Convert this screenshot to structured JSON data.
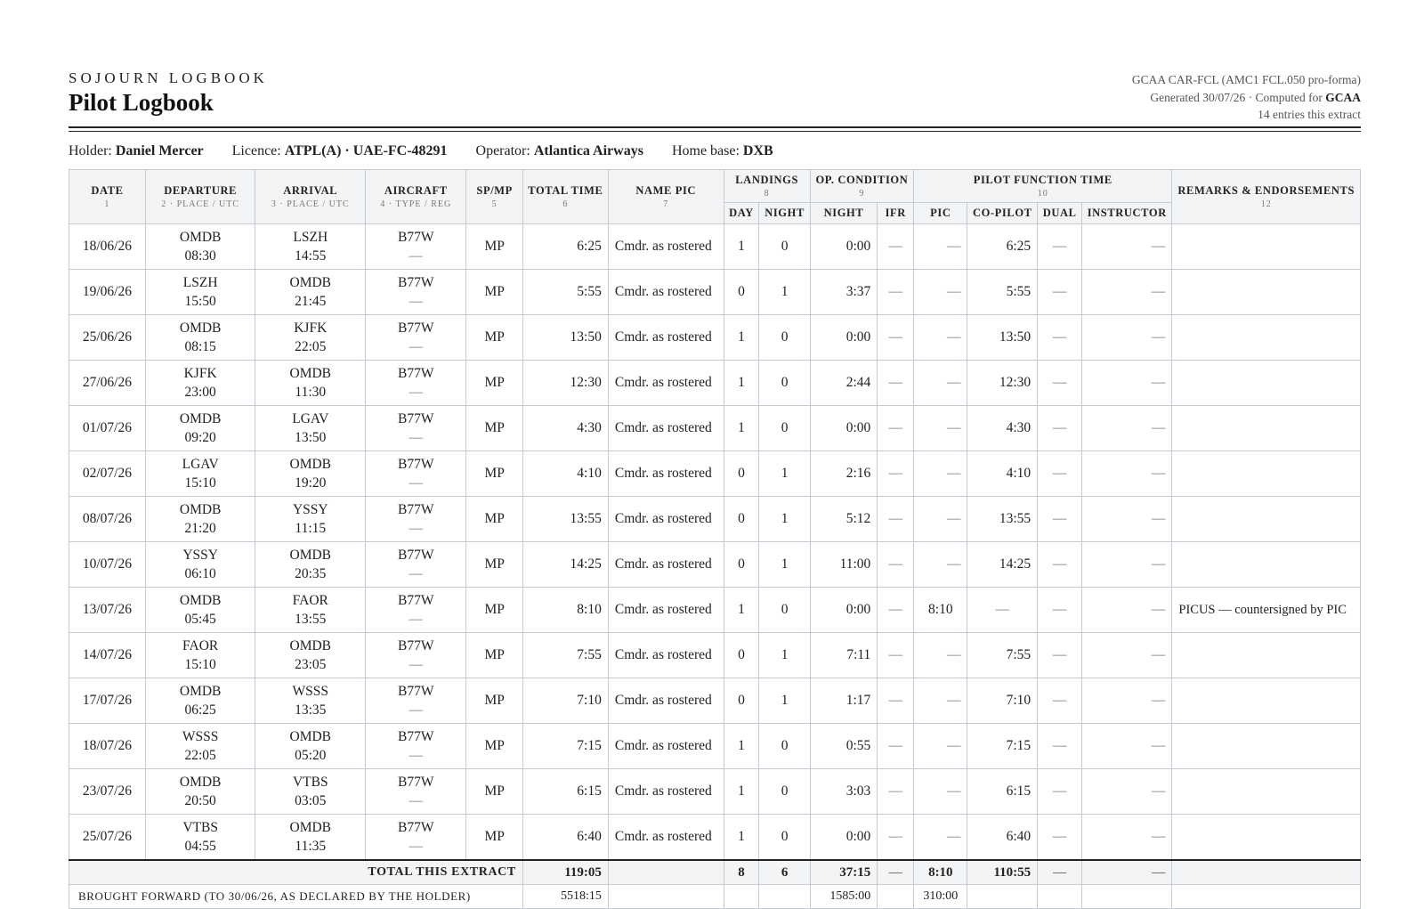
{
  "header": {
    "brand": "SOJOURN LOGBOOK",
    "title": "Pilot Logbook",
    "meta_line1": "GCAA CAR-FCL (AMC1 FCL.050 pro-forma)",
    "meta_line2_prefix": "Generated 30/07/26 · Computed for ",
    "meta_line2_bold": "GCAA",
    "meta_line3": "14 entries this extract"
  },
  "holder": {
    "holder_label": "Holder:",
    "holder_value": "Daniel Mercer",
    "licence_label": "Licence:",
    "licence_value": "ATPL(A) · UAE-FC-48291",
    "operator_label": "Operator:",
    "operator_value": "Atlantica Airways",
    "base_label": "Home base:",
    "base_value": "DXB"
  },
  "columns": {
    "date": "DATE",
    "date_n": "1",
    "dep": "DEPARTURE",
    "dep_n": "2 · PLACE / UTC",
    "arr": "ARRIVAL",
    "arr_n": "3 · PLACE / UTC",
    "ac": "AIRCRAFT",
    "ac_n": "4 · TYPE / REG",
    "spmp": "SP/MP",
    "spmp_n": "5",
    "total": "TOTAL TIME",
    "total_n": "6",
    "pic_name": "NAME PIC",
    "pic_name_n": "7",
    "landings": "LANDINGS",
    "landings_n": "8",
    "opcond": "OP. CONDITION",
    "opcond_n": "9",
    "pft": "PILOT FUNCTION TIME",
    "pft_n": "10",
    "remarks": "REMARKS & ENDORSEMENTS",
    "remarks_n": "12",
    "day": "DAY",
    "night_l": "NIGHT",
    "night_c": "NIGHT",
    "ifr": "IFR",
    "pic": "PIC",
    "copilot": "CO-PILOT",
    "dual": "DUAL",
    "instructor": "INSTRUCTOR"
  },
  "rows": [
    {
      "date": "18/06/26",
      "dep": "OMDB",
      "dep_t": "08:30",
      "arr": "LSZH",
      "arr_t": "14:55",
      "type": "B77W",
      "reg": "—",
      "spmp": "MP",
      "total": "6:25",
      "name": "Cmdr. as rostered",
      "day": "1",
      "nightl": "0",
      "night": "0:00",
      "ifr": "—",
      "pic": "—",
      "cop": "6:25",
      "dual": "—",
      "instr": "—",
      "rem": ""
    },
    {
      "date": "19/06/26",
      "dep": "LSZH",
      "dep_t": "15:50",
      "arr": "OMDB",
      "arr_t": "21:45",
      "type": "B77W",
      "reg": "—",
      "spmp": "MP",
      "total": "5:55",
      "name": "Cmdr. as rostered",
      "day": "0",
      "nightl": "1",
      "night": "3:37",
      "ifr": "—",
      "pic": "—",
      "cop": "5:55",
      "dual": "—",
      "instr": "—",
      "rem": ""
    },
    {
      "date": "25/06/26",
      "dep": "OMDB",
      "dep_t": "08:15",
      "arr": "KJFK",
      "arr_t": "22:05",
      "type": "B77W",
      "reg": "—",
      "spmp": "MP",
      "total": "13:50",
      "name": "Cmdr. as rostered",
      "day": "1",
      "nightl": "0",
      "night": "0:00",
      "ifr": "—",
      "pic": "—",
      "cop": "13:50",
      "dual": "—",
      "instr": "—",
      "rem": ""
    },
    {
      "date": "27/06/26",
      "dep": "KJFK",
      "dep_t": "23:00",
      "arr": "OMDB",
      "arr_t": "11:30",
      "type": "B77W",
      "reg": "—",
      "spmp": "MP",
      "total": "12:30",
      "name": "Cmdr. as rostered",
      "day": "1",
      "nightl": "0",
      "night": "2:44",
      "ifr": "—",
      "pic": "—",
      "cop": "12:30",
      "dual": "—",
      "instr": "—",
      "rem": ""
    },
    {
      "date": "01/07/26",
      "dep": "OMDB",
      "dep_t": "09:20",
      "arr": "LGAV",
      "arr_t": "13:50",
      "type": "B77W",
      "reg": "—",
      "spmp": "MP",
      "total": "4:30",
      "name": "Cmdr. as rostered",
      "day": "1",
      "nightl": "0",
      "night": "0:00",
      "ifr": "—",
      "pic": "—",
      "cop": "4:30",
      "dual": "—",
      "instr": "—",
      "rem": ""
    },
    {
      "date": "02/07/26",
      "dep": "LGAV",
      "dep_t": "15:10",
      "arr": "OMDB",
      "arr_t": "19:20",
      "type": "B77W",
      "reg": "—",
      "spmp": "MP",
      "total": "4:10",
      "name": "Cmdr. as rostered",
      "day": "0",
      "nightl": "1",
      "night": "2:16",
      "ifr": "—",
      "pic": "—",
      "cop": "4:10",
      "dual": "—",
      "instr": "—",
      "rem": ""
    },
    {
      "date": "08/07/26",
      "dep": "OMDB",
      "dep_t": "21:20",
      "arr": "YSSY",
      "arr_t": "11:15",
      "type": "B77W",
      "reg": "—",
      "spmp": "MP",
      "total": "13:55",
      "name": "Cmdr. as rostered",
      "day": "0",
      "nightl": "1",
      "night": "5:12",
      "ifr": "—",
      "pic": "—",
      "cop": "13:55",
      "dual": "—",
      "instr": "—",
      "rem": ""
    },
    {
      "date": "10/07/26",
      "dep": "YSSY",
      "dep_t": "06:10",
      "arr": "OMDB",
      "arr_t": "20:35",
      "type": "B77W",
      "reg": "—",
      "spmp": "MP",
      "total": "14:25",
      "name": "Cmdr. as rostered",
      "day": "0",
      "nightl": "1",
      "night": "11:00",
      "ifr": "—",
      "pic": "—",
      "cop": "14:25",
      "dual": "—",
      "instr": "—",
      "rem": ""
    },
    {
      "date": "13/07/26",
      "dep": "OMDB",
      "dep_t": "05:45",
      "arr": "FAOR",
      "arr_t": "13:55",
      "type": "B77W",
      "reg": "—",
      "spmp": "MP",
      "total": "8:10",
      "name": "Cmdr. as rostered",
      "day": "1",
      "nightl": "0",
      "night": "0:00",
      "ifr": "—",
      "pic": "8:10",
      "cop": "—",
      "dual": "—",
      "instr": "—",
      "rem": "PICUS — countersigned by PIC"
    },
    {
      "date": "14/07/26",
      "dep": "FAOR",
      "dep_t": "15:10",
      "arr": "OMDB",
      "arr_t": "23:05",
      "type": "B77W",
      "reg": "—",
      "spmp": "MP",
      "total": "7:55",
      "name": "Cmdr. as rostered",
      "day": "0",
      "nightl": "1",
      "night": "7:11",
      "ifr": "—",
      "pic": "—",
      "cop": "7:55",
      "dual": "—",
      "instr": "—",
      "rem": ""
    },
    {
      "date": "17/07/26",
      "dep": "OMDB",
      "dep_t": "06:25",
      "arr": "WSSS",
      "arr_t": "13:35",
      "type": "B77W",
      "reg": "—",
      "spmp": "MP",
      "total": "7:10",
      "name": "Cmdr. as rostered",
      "day": "0",
      "nightl": "1",
      "night": "1:17",
      "ifr": "—",
      "pic": "—",
      "cop": "7:10",
      "dual": "—",
      "instr": "—",
      "rem": ""
    },
    {
      "date": "18/07/26",
      "dep": "WSSS",
      "dep_t": "22:05",
      "arr": "OMDB",
      "arr_t": "05:20",
      "type": "B77W",
      "reg": "—",
      "spmp": "MP",
      "total": "7:15",
      "name": "Cmdr. as rostered",
      "day": "1",
      "nightl": "0",
      "night": "0:55",
      "ifr": "—",
      "pic": "—",
      "cop": "7:15",
      "dual": "—",
      "instr": "—",
      "rem": ""
    },
    {
      "date": "23/07/26",
      "dep": "OMDB",
      "dep_t": "20:50",
      "arr": "VTBS",
      "arr_t": "03:05",
      "type": "B77W",
      "reg": "—",
      "spmp": "MP",
      "total": "6:15",
      "name": "Cmdr. as rostered",
      "day": "1",
      "nightl": "0",
      "night": "3:03",
      "ifr": "—",
      "pic": "—",
      "cop": "6:15",
      "dual": "—",
      "instr": "—",
      "rem": ""
    },
    {
      "date": "25/07/26",
      "dep": "VTBS",
      "dep_t": "04:55",
      "arr": "OMDB",
      "arr_t": "11:35",
      "type": "B77W",
      "reg": "—",
      "spmp": "MP",
      "total": "6:40",
      "name": "Cmdr. as rostered",
      "day": "1",
      "nightl": "0",
      "night": "0:00",
      "ifr": "—",
      "pic": "—",
      "cop": "6:40",
      "dual": "—",
      "instr": "—",
      "rem": ""
    }
  ],
  "total": {
    "label": "TOTAL THIS EXTRACT",
    "total": "119:05",
    "day": "8",
    "nightl": "6",
    "night": "37:15",
    "ifr": "—",
    "pic": "8:10",
    "cop": "110:55",
    "dual": "—",
    "instr": "—"
  },
  "forward": {
    "label": "BROUGHT FORWARD (TO 30/06/26, AS DECLARED BY THE HOLDER)",
    "total": "5518:15",
    "night": "1585:00",
    "pic": "310:00"
  }
}
